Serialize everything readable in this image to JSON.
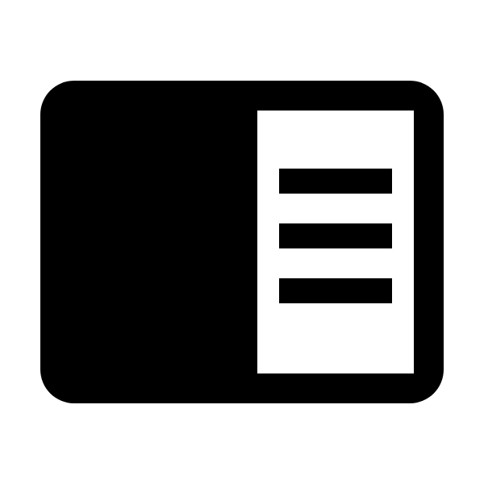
{
  "icon": {
    "name": "side-panel-menu-icon",
    "foreground_color": "#000000",
    "background_color": "#ffffff",
    "panel_color": "#ffffff",
    "menu_lines": 3
  }
}
